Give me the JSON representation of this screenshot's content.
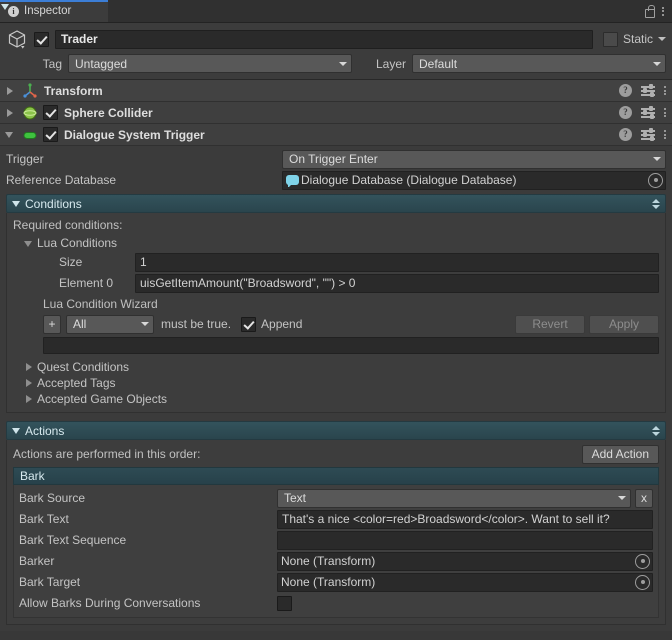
{
  "window": {
    "tab_label": "Inspector",
    "tab_icon": "info-icon",
    "lock_icon": "lock-icon",
    "menu_icon": "kebab-menu-icon"
  },
  "gameobject": {
    "icon": "cube-icon",
    "active": true,
    "name": "Trader",
    "static_label": "Static",
    "static_checked": false,
    "tag_label": "Tag",
    "tag_value": "Untagged",
    "layer_label": "Layer",
    "layer_value": "Default"
  },
  "components": [
    {
      "title": "Transform",
      "icon": "transform-axis-icon",
      "expanded": false,
      "has_enable_toggle": false,
      "enabled": false
    },
    {
      "title": "Sphere Collider",
      "icon": "sphere-collider-icon",
      "expanded": false,
      "has_enable_toggle": true,
      "enabled": true
    },
    {
      "title": "Dialogue System Trigger",
      "icon": "dialogue-system-trigger-icon",
      "expanded": true,
      "has_enable_toggle": true,
      "enabled": true
    }
  ],
  "header_icons": {
    "help": "?",
    "preset": "preset-icon",
    "menu": "kebab-menu-icon"
  },
  "trigger_row": {
    "label": "Trigger",
    "value": "On Trigger Enter"
  },
  "reference_database_row": {
    "label": "Reference Database",
    "value": "Dialogue Database (Dialogue Database)",
    "icon": "dialogue-database-icon"
  },
  "conditions": {
    "title": "Conditions",
    "expanded": true,
    "required_label": "Required conditions:",
    "lua_conditions": {
      "title": "Lua Conditions",
      "expanded": true,
      "size_label": "Size",
      "size_value": "1",
      "element_label": "Element 0",
      "element_value": "uisGetItemAmount(\"Broadsword\", \"\") > 0"
    },
    "wizard": {
      "title": "Lua Condition Wizard",
      "add_button": "+",
      "mode_value": "All",
      "must_be_true_label": "must be true.",
      "append_label": "Append",
      "append_checked": true,
      "revert_label": "Revert",
      "apply_label": "Apply",
      "revert_enabled": false,
      "apply_enabled": false
    },
    "foldouts": [
      {
        "label": "Quest Conditions",
        "expanded": false
      },
      {
        "label": "Accepted Tags",
        "expanded": false
      },
      {
        "label": "Accepted Game Objects",
        "expanded": false
      }
    ]
  },
  "actions": {
    "title": "Actions",
    "expanded": true,
    "order_hint": "Actions are performed in this order:",
    "add_action_label": "Add Action",
    "bark": {
      "title": "Bark",
      "expanded": true,
      "fields": [
        {
          "label": "Bark Source",
          "value": "Text",
          "type": "dropdown",
          "clear_label": "x"
        },
        {
          "label": "Bark Text",
          "value": "That's a nice <color=red>Broadsword</color>. Want to sell it?",
          "type": "text"
        },
        {
          "label": "Bark Text Sequence",
          "value": "",
          "type": "text"
        },
        {
          "label": "Barker",
          "value": "None (Transform)",
          "type": "object"
        },
        {
          "label": "Bark Target",
          "value": "None (Transform)",
          "type": "object"
        },
        {
          "label": "Allow Barks During Conversations",
          "value": "",
          "type": "checkbox",
          "checked": false
        }
      ]
    }
  },
  "colors": {
    "background": "#383838",
    "panel": "#3b3b3b",
    "section_header": "#2d4a52",
    "accent_tab": "#3c7ed6",
    "field": "#2a2a2a",
    "component_icon_green": "#7ac943"
  }
}
